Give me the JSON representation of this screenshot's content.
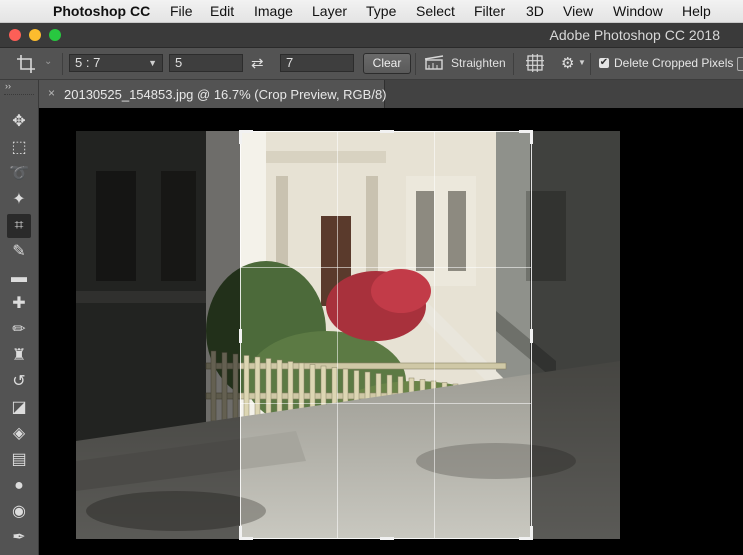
{
  "menubar": {
    "apple_glyph": "",
    "app_name": "Photoshop CC",
    "items": [
      "File",
      "Edit",
      "Image",
      "Layer",
      "Type",
      "Select",
      "Filter",
      "3D",
      "View",
      "Window",
      "Help"
    ]
  },
  "window": {
    "title": "Adobe Photoshop CC 2018"
  },
  "options": {
    "tool_icon": "crop-icon",
    "ratio_preset": "5 : 7",
    "width_value": "5",
    "swap_icon": "swap-arrows-icon",
    "height_value": "7",
    "clear_label": "Clear",
    "straighten_label": "Straighten",
    "overlay_icon": "grid-overlay-icon",
    "settings_icon": "gear-icon",
    "delete_cropped_label": "Delete Cropped Pixels",
    "delete_cropped_checked": true
  },
  "toolbar": {
    "collapse_glyph": "››",
    "tools": [
      {
        "name": "move-tool",
        "glyph": "✥"
      },
      {
        "name": "marquee-tool",
        "glyph": "⬚"
      },
      {
        "name": "lasso-tool",
        "glyph": "➰"
      },
      {
        "name": "magic-wand-tool",
        "glyph": "✦"
      },
      {
        "name": "crop-tool",
        "glyph": "⌗",
        "active": true
      },
      {
        "name": "eyedropper-tool",
        "glyph": "✎"
      },
      {
        "name": "ruler-tool",
        "glyph": "▬"
      },
      {
        "name": "healing-brush-tool",
        "glyph": "✚"
      },
      {
        "name": "brush-tool",
        "glyph": "✏"
      },
      {
        "name": "clone-stamp-tool",
        "glyph": "♜"
      },
      {
        "name": "history-brush-tool",
        "glyph": "↺"
      },
      {
        "name": "eraser-tool",
        "glyph": "◪"
      },
      {
        "name": "paint-bucket-tool",
        "glyph": "◈"
      },
      {
        "name": "gradient-tool",
        "glyph": "▤"
      },
      {
        "name": "blur-tool",
        "glyph": "●"
      },
      {
        "name": "dodge-tool",
        "glyph": "◉"
      },
      {
        "name": "pen-tool",
        "glyph": "✒"
      }
    ]
  },
  "document": {
    "tab_close_glyph": "×",
    "tab_title": "20130525_154853.jpg @ 16.7% (Crop Preview, RGB/8)"
  },
  "colors": {
    "menubar_bg": "#e8e8e8",
    "panel_bg": "#535353",
    "canvas_bg": "#000000",
    "traffic_red": "#fc5f57",
    "traffic_yellow": "#fdbc2e",
    "traffic_green": "#28c840"
  }
}
